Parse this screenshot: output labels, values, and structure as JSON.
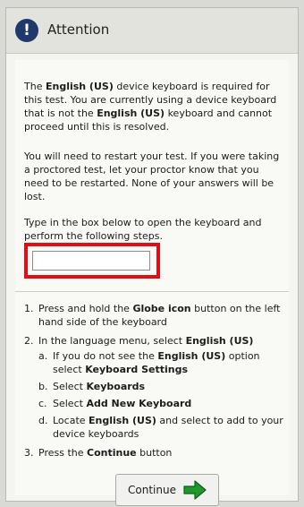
{
  "dialog": {
    "title": "Attention",
    "intro": {
      "t1": "The ",
      "b1": "English (US)",
      "t2": " device keyboard is required for this test. You are currently using a device keyboard that is not the ",
      "b2": "English (US)",
      "t3": " keyboard and cannot proceed until this is resolved."
    },
    "restart_text": "You will need to restart your test. If you were taking a proctored test, let your proctor know that you need to be restarted. None of your answers will be lost.",
    "type_instruction": "Type in the box below to open the keyboard and perform the following steps.",
    "input_value": "",
    "steps": {
      "s1": {
        "num": "1.",
        "t1": "Press and hold the ",
        "b1": "Globe icon",
        "t2": " button on the left hand side of the keyboard"
      },
      "s2": {
        "num": "2.",
        "t1": "In the language menu, select ",
        "b1": "English (US)",
        "a": {
          "num": "a.",
          "t1": "If you do not see the ",
          "b1": "English (US)",
          "t2": " option select ",
          "b2": "Keyboard Settings"
        },
        "b": {
          "num": "b.",
          "t1": "Select ",
          "b1": "Keyboards"
        },
        "c": {
          "num": "c.",
          "t1": "Select ",
          "b1": "Add New Keyboard"
        },
        "d": {
          "num": "d.",
          "t1": "Locate ",
          "b1": "English (US)",
          "t2": " and select to add to your device keyboards"
        }
      },
      "s3": {
        "num": "3.",
        "t1": "Press the ",
        "b1": "Continue",
        "t2": " button"
      }
    },
    "continue_label": "Continue",
    "icons": {
      "alert": "exclamation-circle-icon",
      "continue": "green-arrow-right-icon"
    },
    "colors": {
      "alert_icon": "#1f3a6a",
      "highlight_box": "#e00f17",
      "continue_arrow": "#1d9a2b"
    }
  }
}
